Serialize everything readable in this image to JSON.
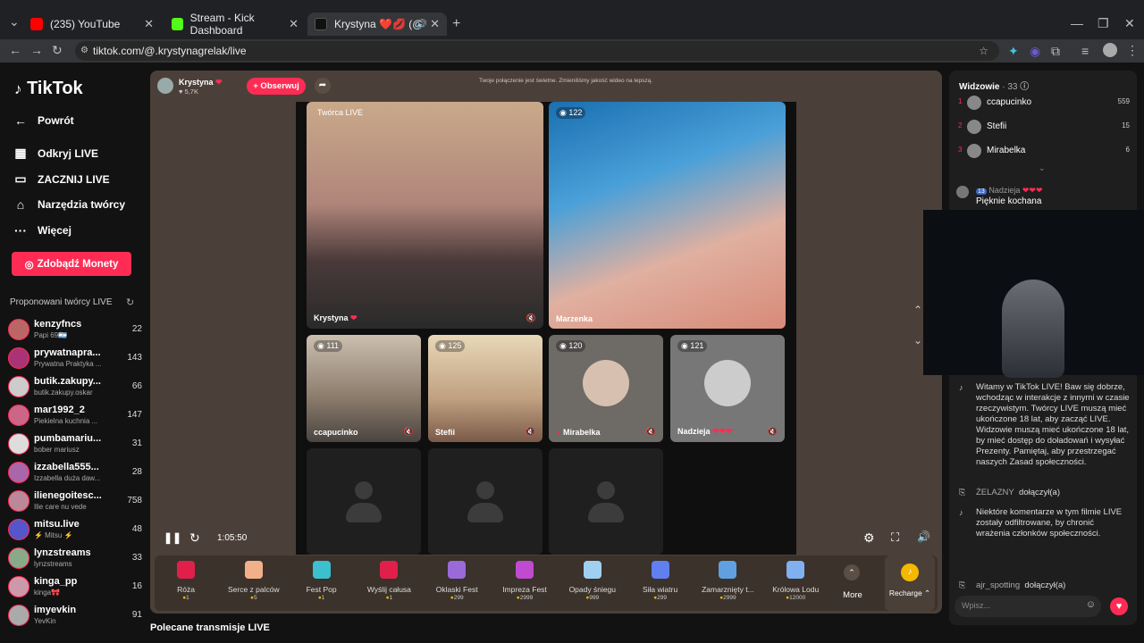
{
  "browser": {
    "tabs": [
      {
        "title": "(235) YouTube"
      },
      {
        "title": "Stream - Kick Dashboard"
      },
      {
        "title": "Krystyna ❤️💋 (@kryst"
      }
    ],
    "url": "tiktok.com/@.krystynagrelak/live"
  },
  "sidebar": {
    "logo": "TikTok",
    "back": "Powrót",
    "nav": [
      "Odkryj LIVE",
      "ZACZNIJ LIVE",
      "Narzędzia twórcy",
      "Więcej"
    ],
    "coins_button": "Zdobądź Monety",
    "suggested_title": "Proponowani twórcy LIVE",
    "suggested": [
      {
        "name": "kenzyfncs",
        "sub": "Papi 69🇦🇷",
        "count": "22"
      },
      {
        "name": "prywatnapra...",
        "sub": "Prywatna Praktyka ...",
        "count": "143"
      },
      {
        "name": "butik.zakupy...",
        "sub": "butik.zakupy.oskar",
        "count": "66"
      },
      {
        "name": "mar1992_2",
        "sub": "Piekielna kuchnia ...",
        "count": "147"
      },
      {
        "name": "pumbamariu...",
        "sub": "bober mariusz",
        "count": "31"
      },
      {
        "name": "izzabella555...",
        "sub": "Izzabella duża daw...",
        "count": "28"
      },
      {
        "name": "ilienegoitesc...",
        "sub": "Ilie care nu vede",
        "count": "758"
      },
      {
        "name": "mitsu.live",
        "sub": "⚡ Mitsu ⚡",
        "count": "48"
      },
      {
        "name": "lynzstreams",
        "sub": "lynzstreams",
        "count": "33"
      },
      {
        "name": "kinga_pp",
        "sub": "kinga🎀",
        "count": "16"
      },
      {
        "name": "imyevkin",
        "sub": "YevKin",
        "count": "91"
      }
    ]
  },
  "stream": {
    "host_name": "Krystyna",
    "host_likes": "5,7K",
    "follow_button": "+ Obserwuj",
    "notice": "Twoje połączenie jest świetne. Zmieniliśmy jakość wideo na lepszą.",
    "creator_label": "Twórca LIVE",
    "host_tile_name": "Krystyna",
    "guests": [
      {
        "name": "Marzenka",
        "count": "122"
      },
      {
        "name": "ccapucinko",
        "count": "111"
      },
      {
        "name": "Stefii",
        "count": "125"
      },
      {
        "name": "Mirabelka",
        "count": "120"
      },
      {
        "name": "Nadzieja",
        "count": "121"
      }
    ],
    "time": "1:05:50",
    "below_title": "Polecane transmisje LIVE"
  },
  "gifts": [
    {
      "name": "Róża",
      "price": "1"
    },
    {
      "name": "Serce z palców",
      "price": "5"
    },
    {
      "name": "Fest Pop",
      "price": "1"
    },
    {
      "name": "Wyślij całusa",
      "price": "1"
    },
    {
      "name": "Oklaski Fest",
      "price": "299"
    },
    {
      "name": "Impreza Fest",
      "price": "2999"
    },
    {
      "name": "Opady śniegu",
      "price": "999"
    },
    {
      "name": "Siła wiatru",
      "price": "299"
    },
    {
      "name": "Zamarznięty t...",
      "price": "2999"
    },
    {
      "name": "Królowa Lodu",
      "price": "12000"
    }
  ],
  "gift_more": "More",
  "recharge": "Recharge",
  "viewers": {
    "title": "Widzowie",
    "count": "· 33",
    "top": [
      {
        "rank": "1",
        "name": "ccapucinko",
        "score": "559"
      },
      {
        "rank": "2",
        "name": "Stefii",
        "score": "15"
      },
      {
        "rank": "3",
        "name": "Mirabelka",
        "score": "6"
      }
    ]
  },
  "chat": {
    "msg1_user": "Nadzieja",
    "msg1_text": "Pięknie kochana",
    "welcome": "Witamy w TikTok LIVE! Baw się dobrze, wchodząc w interakcje z innymi w czasie rzeczywistym. Twórcy LIVE muszą mieć ukończone 18 lat, aby zacząć LIVE. Widzowie muszą mieć ukończone 18 lat, by mieć dostęp do doładowań i wysyłać Prezenty. Pamiętaj, aby przestrzegać naszych Zasad społeczności.",
    "join1_user": "ŻELAZNY",
    "join_text": "dołączył(a)",
    "filtered": "Niektóre komentarze w tym filmie LIVE zostały odfiltrowane, by chronić wrażenia członków społeczności.",
    "join2_user": "ajr_spotting",
    "input_placeholder": "Wpisz..."
  }
}
